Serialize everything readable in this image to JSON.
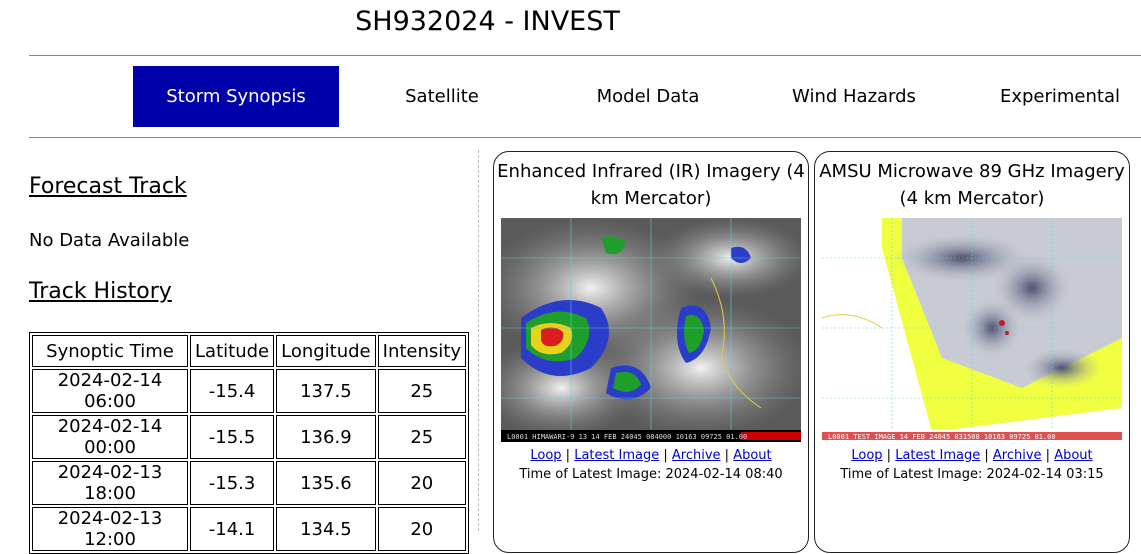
{
  "title": "SH932024 - INVEST",
  "nav": {
    "tabs": [
      {
        "label": "Storm Synopsis",
        "active": true
      },
      {
        "label": "Satellite",
        "active": false
      },
      {
        "label": "Model Data",
        "active": false
      },
      {
        "label": "Wind Hazards",
        "active": false
      },
      {
        "label": "Experimental",
        "active": false
      }
    ]
  },
  "forecast": {
    "heading": "Forecast Track",
    "text": "No Data Available"
  },
  "history": {
    "heading": "Track History",
    "columns": [
      "Synoptic Time",
      "Latitude",
      "Longitude",
      "Intensity"
    ],
    "rows": [
      [
        "2024-02-14 06:00",
        "-15.4",
        "137.5",
        "25"
      ],
      [
        "2024-02-14 00:00",
        "-15.5",
        "136.9",
        "25"
      ],
      [
        "2024-02-13 18:00",
        "-15.3",
        "135.6",
        "20"
      ],
      [
        "2024-02-13 12:00",
        "-14.1",
        "134.5",
        "20"
      ]
    ]
  },
  "panels": [
    {
      "title": "Enhanced Infrared (IR) Imagery (4 km Mercator)",
      "links": [
        "Loop",
        "Latest Image",
        "Archive",
        "About"
      ],
      "latest": "Time of Latest Image: 2024-02-14 08:40",
      "caption": "L0001 HIMAWARI-9 13 14 FEB 24045 084000 10163 09725 01.00"
    },
    {
      "title": "AMSU Microwave 89 GHz Imagery (4 km Mercator)",
      "links": [
        "Loop",
        "Latest Image",
        "Archive",
        "About"
      ],
      "latest": "Time of Latest Image: 2024-02-14 03:15",
      "caption": "L0001 TEST IMAGE 14 FEB 24045 031500 10163 09725 01.00"
    }
  ],
  "colors": {
    "active_tab": "#0000aa",
    "link": "#0000cc"
  }
}
